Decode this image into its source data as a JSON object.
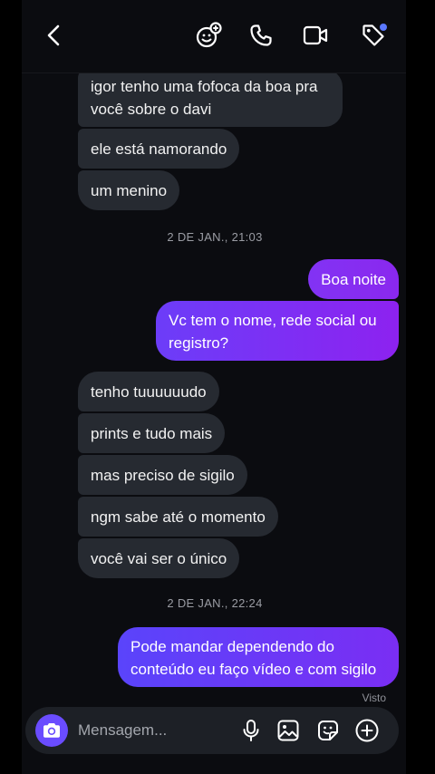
{
  "header": {
    "icons": [
      "back-icon",
      "add-person-icon",
      "phone-icon",
      "video-icon",
      "tag-icon"
    ]
  },
  "thread": {
    "group1": [
      "igor tenho uma fofoca da boa pra",
      "você sobre o davi",
      "ele está namorando",
      "um menino"
    ],
    "timestamp1": "2 DE JAN., 21:03",
    "sent1": [
      "Boa noite",
      "Vc tem o nome, rede social ou",
      "registro?"
    ],
    "group2": [
      "tenho tuuuuuudo",
      "prints e tudo mais",
      "mas preciso de sigilo",
      "ngm sabe até o momento",
      "você vai ser o único"
    ],
    "timestamp2": "2 DE JAN., 22:24",
    "sent2": [
      "Pode mandar dependendo do",
      "conteúdo eu faço vídeo e com sigilo"
    ],
    "seen_label": "Visto"
  },
  "composer": {
    "placeholder": "Mensagem...",
    "icons": [
      "camera-icon",
      "microphone-icon",
      "image-icon",
      "sticker-icon",
      "plus-icon"
    ]
  },
  "colors": {
    "background": "#000000",
    "panel": "#0b0c10",
    "incoming_bubble": "#262a31",
    "outgoing_gradient_start": "#4b4dff",
    "outgoing_gradient_end": "#8d22f0",
    "camera_button": "#6a4cff",
    "notification_dot": "#5a78ff"
  }
}
